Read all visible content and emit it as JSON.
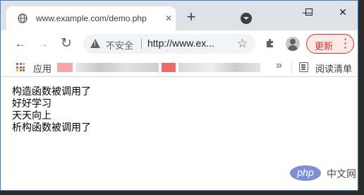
{
  "tab": {
    "title": "www.example.com/demo.php",
    "favicon": "globe-icon",
    "close_glyph": "✕"
  },
  "new_tab_glyph": "+",
  "window_controls": {
    "minimize": "—",
    "maximize": "☐",
    "close": "✕"
  },
  "toolbar": {
    "back_glyph": "←",
    "forward_glyph": "→",
    "reload_glyph": "↻",
    "security_label": "不安全",
    "url": "http://www.ex...",
    "bookmark_glyph": "☆",
    "update_label": "更新",
    "menu_glyph": "⋮"
  },
  "bookmarks": {
    "apps_label": "应用",
    "overflow_glyph": "»",
    "reading_list_label": "阅读清单"
  },
  "content": {
    "lines": [
      "构造函数被调用了",
      "好好学习",
      "天天向上",
      "析构函数被调用了"
    ]
  },
  "watermark": {
    "logo_text": "php",
    "site_text": "中文网"
  },
  "colors": {
    "titlebar": "#dee1e6",
    "update_red": "#d93025",
    "watermark_blue": "#7e8fd6"
  }
}
